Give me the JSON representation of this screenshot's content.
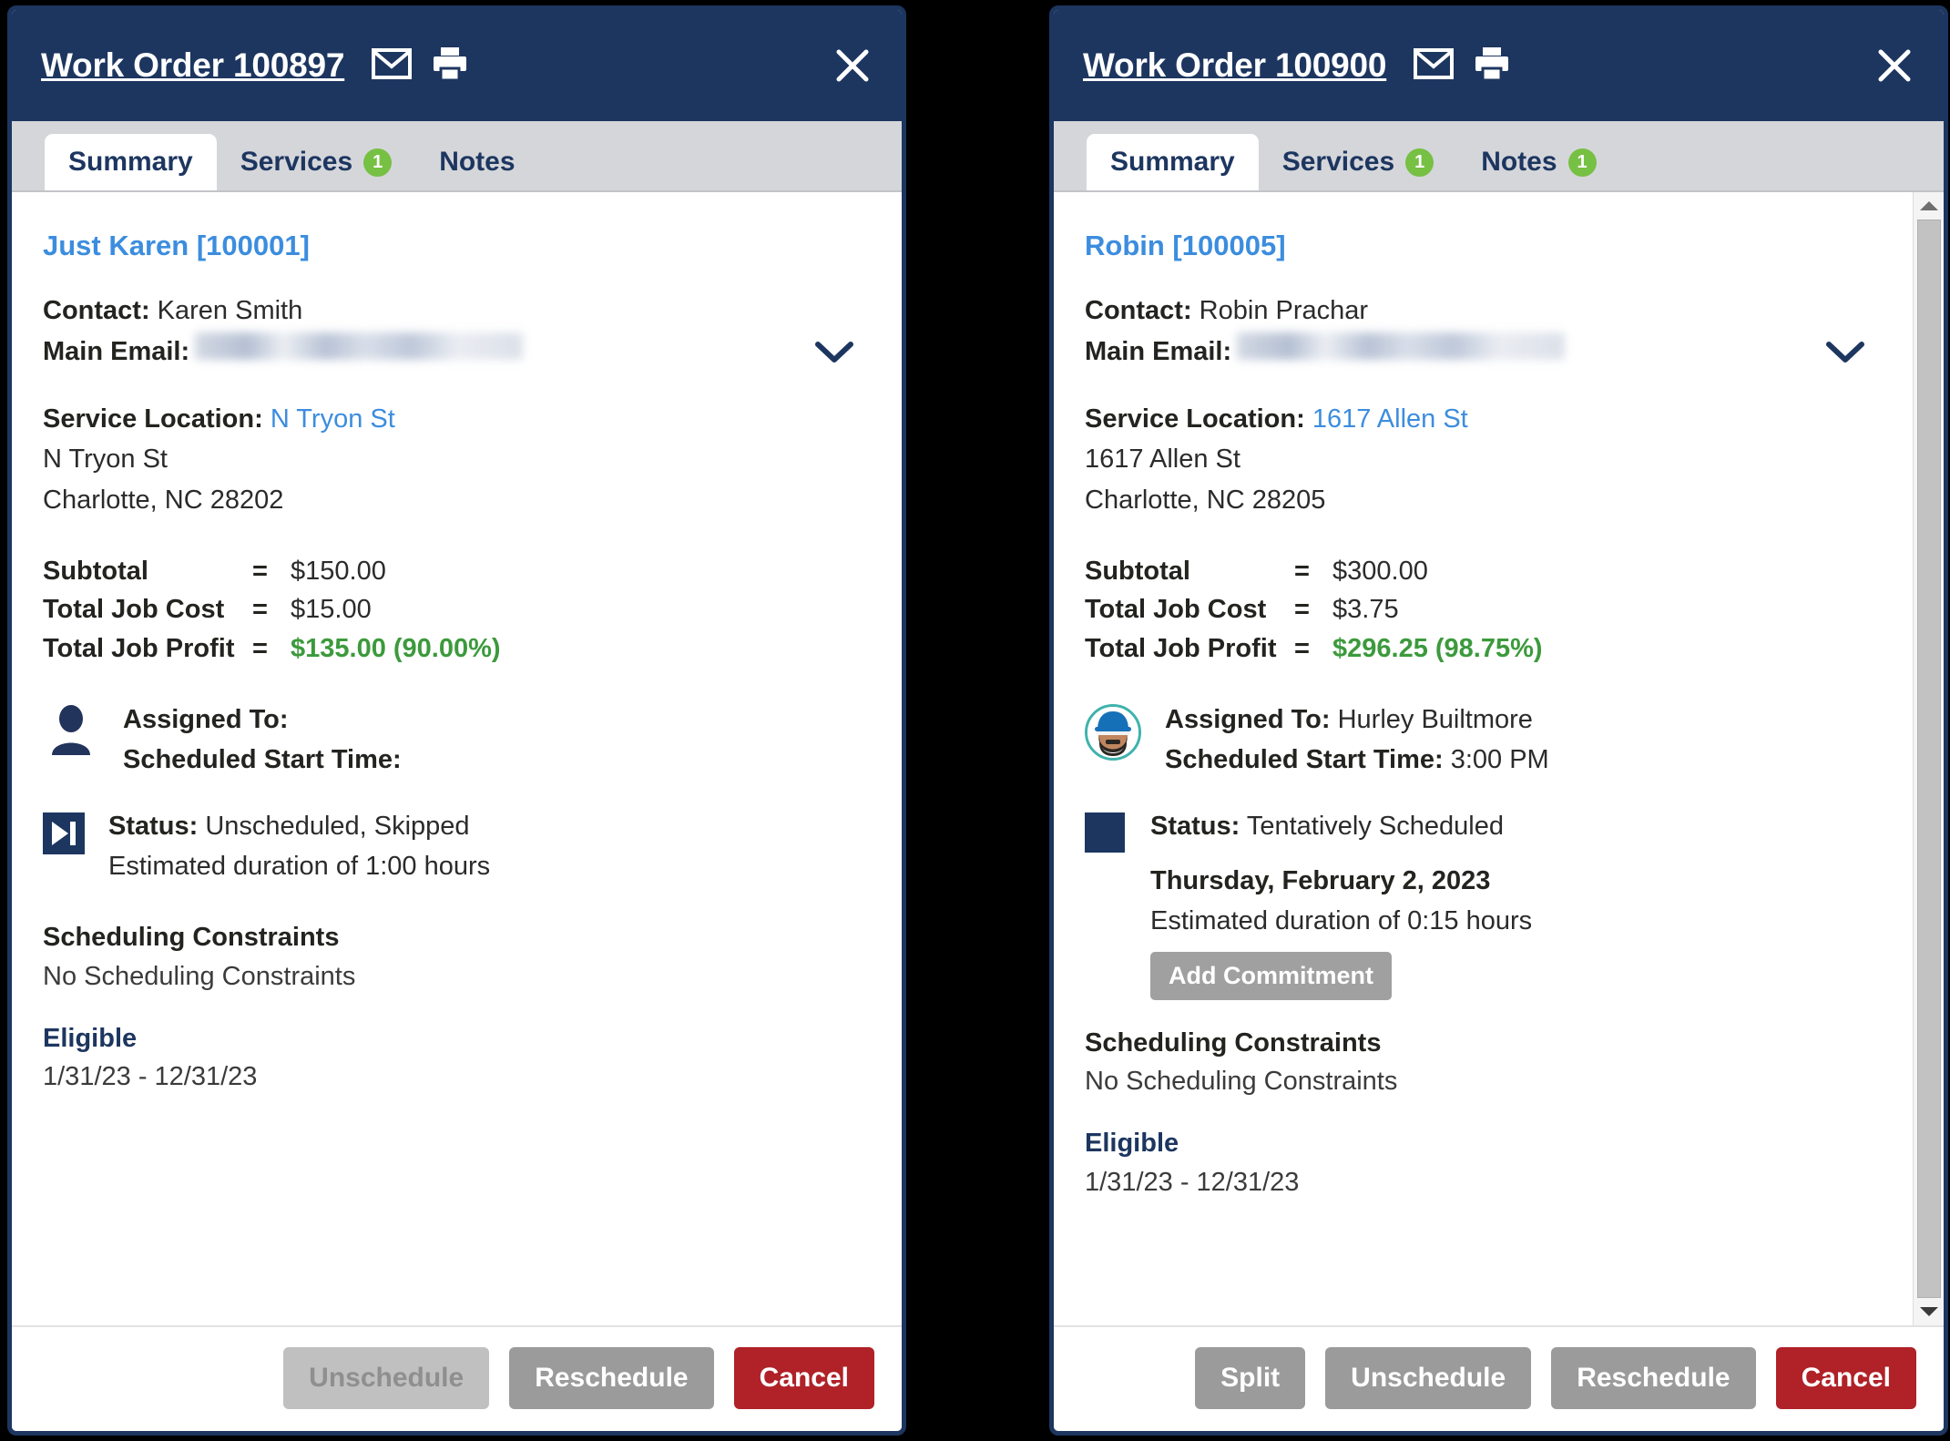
{
  "colors": {
    "titlebar_navy": "#1d3660",
    "tabstrip_grey": "#d5d6da",
    "badge_green": "#76c043",
    "link_blue": "#3c8dde",
    "profit_green": "#3c9a3c",
    "cancel_red": "#b02128",
    "button_grey": "#9b9b9b",
    "button_disabled": "#c0c0c0",
    "avatar_ring_teal": "#3fb3ac"
  },
  "panels": [
    {
      "title": "Work Order 100897",
      "icons": {
        "email": "envelope-icon",
        "print": "printer-icon",
        "close": "close-icon"
      },
      "tabs": [
        {
          "label": "Summary",
          "badge": null,
          "active": true
        },
        {
          "label": "Services",
          "badge": "1",
          "active": false
        },
        {
          "label": "Notes",
          "badge": null,
          "active": false
        }
      ],
      "customer": "Just Karen [100001]",
      "contact_label": "Contact:",
      "contact_value": "Karen Smith",
      "email_label": "Main Email:",
      "email_value": "",
      "service_location_label": "Service Location:",
      "service_location_link": "N Tryon St",
      "address_line1": "N Tryon St",
      "address_line2": "Charlotte, NC 28202",
      "money": [
        {
          "label": "Subtotal",
          "eq": "=",
          "value": "$150.00",
          "profit": false
        },
        {
          "label": "Total Job Cost",
          "eq": "=",
          "value": "$15.00",
          "profit": false
        },
        {
          "label": "Total Job Profit",
          "eq": "=",
          "value": "$135.00 (90.00%)",
          "profit": true
        }
      ],
      "assign_icon": "person-icon",
      "assigned_label": "Assigned To:",
      "assigned_value": "",
      "start_time_label": "Scheduled Start Time:",
      "start_time_value": "",
      "status_icon": "skip-forward-icon",
      "status_label": "Status:",
      "status_value": "Unscheduled, Skipped",
      "scheduled_date": "",
      "duration_text": "Estimated duration of 1:00 hours",
      "add_commitment_label": null,
      "constraints_head": "Scheduling Constraints",
      "constraints_sub": "No Scheduling Constraints",
      "eligible_head": "Eligible",
      "eligible_range": "1/31/23 - 12/31/23",
      "has_scrollbar": false,
      "footer_buttons": [
        {
          "label": "Unschedule",
          "style": "disabled"
        },
        {
          "label": "Reschedule",
          "style": "grey"
        },
        {
          "label": "Cancel",
          "style": "danger"
        }
      ]
    },
    {
      "title": "Work Order 100900",
      "icons": {
        "email": "envelope-icon",
        "print": "printer-icon",
        "close": "close-icon"
      },
      "tabs": [
        {
          "label": "Summary",
          "badge": null,
          "active": true
        },
        {
          "label": "Services",
          "badge": "1",
          "active": false
        },
        {
          "label": "Notes",
          "badge": "1",
          "active": false
        }
      ],
      "customer": "Robin [100005]",
      "contact_label": "Contact:",
      "contact_value": "Robin Prachar",
      "email_label": "Main Email:",
      "email_value": "",
      "service_location_label": "Service Location:",
      "service_location_link": "1617 Allen St",
      "address_line1": "1617 Allen St",
      "address_line2": "Charlotte, NC 28205",
      "money": [
        {
          "label": "Subtotal",
          "eq": "=",
          "value": "$300.00",
          "profit": false
        },
        {
          "label": "Total Job Cost",
          "eq": "=",
          "value": "$3.75",
          "profit": false
        },
        {
          "label": "Total Job Profit",
          "eq": "=",
          "value": "$296.25 (98.75%)",
          "profit": true
        }
      ],
      "assign_icon": "technician-avatar",
      "assigned_label": "Assigned To:",
      "assigned_value": "Hurley Builtmore",
      "start_time_label": "Scheduled Start Time:",
      "start_time_value": "3:00 PM",
      "status_icon": "navy-square-icon",
      "status_label": "Status:",
      "status_value": "Tentatively Scheduled",
      "scheduled_date": "Thursday, February 2, 2023",
      "duration_text": "Estimated duration of 0:15 hours",
      "add_commitment_label": "Add Commitment",
      "constraints_head": "Scheduling Constraints",
      "constraints_sub": "No Scheduling Constraints",
      "eligible_head": "Eligible",
      "eligible_range": "1/31/23 - 12/31/23",
      "has_scrollbar": true,
      "footer_buttons": [
        {
          "label": "Split",
          "style": "grey"
        },
        {
          "label": "Unschedule",
          "style": "grey"
        },
        {
          "label": "Reschedule",
          "style": "grey"
        },
        {
          "label": "Cancel",
          "style": "danger"
        }
      ]
    }
  ]
}
